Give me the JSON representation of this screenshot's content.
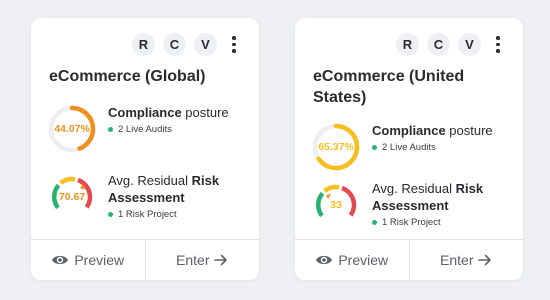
{
  "cards": [
    {
      "title": "eCommerce (Global)",
      "badges": [
        "R",
        "C",
        "V"
      ],
      "compliance": {
        "value": "44.07%",
        "percent": 44.07,
        "label_bold": "Compliance",
        "label_rest": " posture",
        "sub": "2 Live Audits",
        "color": "#f0901e"
      },
      "risk": {
        "value": "70.67",
        "label_a": "Avg. Residual ",
        "label_b": "Risk",
        "label_c": "Assessment",
        "sub": "1 Risk Project",
        "color": "#f0901e"
      },
      "footer": {
        "preview": "Preview",
        "enter": "Enter"
      }
    },
    {
      "title": "eCommerce (United States)",
      "badges": [
        "R",
        "C",
        "V"
      ],
      "compliance": {
        "value": "65.37%",
        "percent": 65.37,
        "label_bold": "Compliance",
        "label_rest": " posture",
        "sub": "2 Live Audits",
        "color": "#f7be1d"
      },
      "risk": {
        "value": "33",
        "label_a": "Avg. Residual ",
        "label_b": "Risk",
        "label_c": "Assessment",
        "sub": "1 Risk Project",
        "color": "#f7be1d"
      },
      "footer": {
        "preview": "Preview",
        "enter": "Enter"
      }
    }
  ],
  "icons": {
    "preview": "eye-icon",
    "enter": "arrow-right-icon",
    "menu": "kebab-menu-icon"
  },
  "colors": {
    "track": "#eceef1",
    "green": "#27b36f",
    "red": "#e5484d",
    "yellow": "#f7be1d",
    "orange": "#f0901e"
  }
}
